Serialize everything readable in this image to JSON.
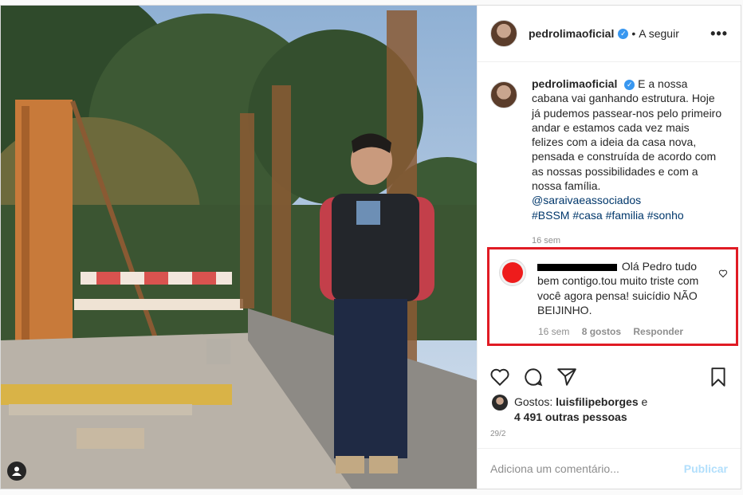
{
  "header": {
    "username": "pedrolimaoficial",
    "verified_mark": "✓",
    "separator": "•",
    "follow_label": "A seguir",
    "more_label": "•••"
  },
  "caption": {
    "username": "pedrolimaoficial",
    "text": "E a nossa cabana vai ganhando estrutura. Hoje já pudemos passear-nos pelo primeiro andar e estamos cada vez mais felizes com a ideia da casa nova, pensada e construída de acordo com as nossas possibilidades e com a nossa família.",
    "mention": "@saraivaeassociados",
    "hashtags": "#BSSM #casa #familia #sonho",
    "time": "16 sem"
  },
  "comment": {
    "username_suffix": "Olá Pedro tudo bem contigo.tou muito triste com você agora pensa! suicídio NÃO BEIJINHO.",
    "time": "16 sem",
    "likes": "8 gostos",
    "reply": "Responder",
    "highlight_color": "#e01b24"
  },
  "engagement": {
    "likes_prefix": "Gostos:",
    "liked_by": "luisfilipeborges",
    "and": "e",
    "others": "4 491 outras pessoas",
    "date": "29/2"
  },
  "add_comment": {
    "placeholder": "Adiciona um comentário...",
    "publish": "Publicar"
  }
}
